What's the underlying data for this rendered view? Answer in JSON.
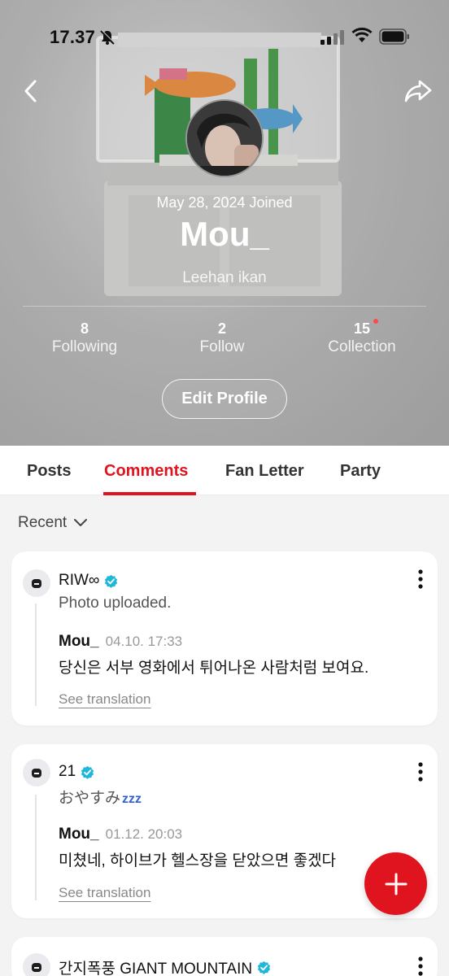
{
  "status_bar": {
    "time": "17.37"
  },
  "profile": {
    "joined": "May 28, 2024 Joined",
    "username": "Mou_",
    "bio": "Leehan ikan",
    "stats": [
      {
        "value": "8",
        "label": "Following"
      },
      {
        "value": "2",
        "label": "Follow"
      },
      {
        "value": "15",
        "label": "Collection"
      }
    ],
    "edit_label": "Edit Profile"
  },
  "tabs": [
    {
      "label": "Posts",
      "active": false
    },
    {
      "label": "Comments",
      "active": true
    },
    {
      "label": "Fan Letter",
      "active": false
    },
    {
      "label": "Party",
      "active": false
    }
  ],
  "sort": {
    "label": "Recent"
  },
  "comments": [
    {
      "author": "RIW∞",
      "post_text": "Photo uploaded.",
      "reply_author": "Mou_",
      "reply_time": "04.10. 17:33",
      "reply_text": "당신은 서부 영화에서 튀어나온 사람처럼 보여요.",
      "translate_label": "See translation"
    },
    {
      "author": "21",
      "post_text": "おやすみ",
      "post_emoji": "zzz",
      "reply_author": "Mou_",
      "reply_time": "01.12. 20:03",
      "reply_text": "미쳤네, 하이브가 헬스장을 닫았으면 좋겠다",
      "translate_label": "See translation"
    },
    {
      "author": "간지폭풍 GIANT MOUNTAIN"
    }
  ],
  "colors": {
    "accent": "#e0141e",
    "verified": "#1fb8d8"
  }
}
